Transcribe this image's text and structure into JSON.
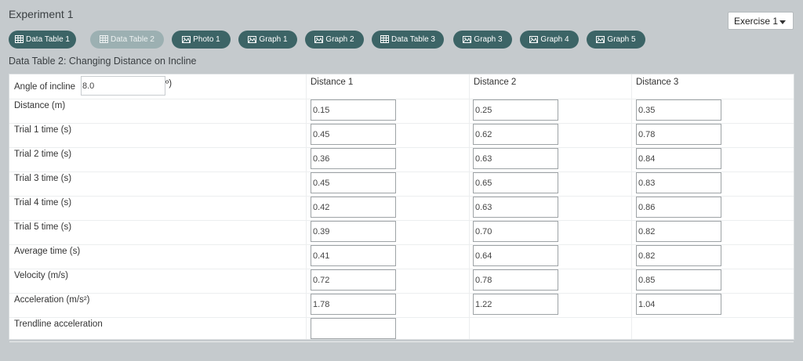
{
  "experiment_title": "Experiment 1",
  "exercise_select": {
    "value": "Exercise 1"
  },
  "tabs": [
    {
      "label": "Data Table 1",
      "icon": "table-icon"
    },
    {
      "label": "Data Table 2",
      "icon": "table-icon"
    },
    {
      "label": "Photo 1",
      "icon": "photo-icon"
    },
    {
      "label": "Graph 1",
      "icon": "graph-icon"
    },
    {
      "label": "Graph 2",
      "icon": "graph-icon"
    },
    {
      "label": "Data Table 3",
      "icon": "table-icon"
    },
    {
      "label": "Graph 3",
      "icon": "graph-icon"
    },
    {
      "label": "Graph 4",
      "icon": "graph-icon"
    },
    {
      "label": "Graph 5",
      "icon": "graph-icon"
    }
  ],
  "active_tab": "Data Table 2",
  "section_title": "Data Table 2: Changing Distance on Incline",
  "table": {
    "angle_label": "Angle of incline",
    "angle_value": "8.0",
    "angle_unit": "º)",
    "columns": [
      "Distance 1",
      "Distance 2",
      "Distance 3"
    ],
    "rows": [
      {
        "label": "Distance (m)",
        "values": [
          "0.15",
          "0.25",
          "0.35"
        ]
      },
      {
        "label": "Trial 1 time (s)",
        "values": [
          "0.45",
          "0.62",
          "0.78"
        ]
      },
      {
        "label": "Trial 2 time (s)",
        "values": [
          "0.36",
          "0.63",
          "0.84"
        ]
      },
      {
        "label": "Trial 3 time (s)",
        "values": [
          "0.45",
          "0.65",
          "0.83"
        ]
      },
      {
        "label": "Trial 4 time (s)",
        "values": [
          "0.42",
          "0.63",
          "0.86"
        ]
      },
      {
        "label": "Trial 5 time (s)",
        "values": [
          "0.39",
          "0.70",
          "0.82"
        ]
      },
      {
        "label": "Average time (s)",
        "values": [
          "0.41",
          "0.64",
          "0.82"
        ]
      },
      {
        "label": "Velocity (m/s)",
        "values": [
          "0.72",
          "0.78",
          "0.85"
        ]
      },
      {
        "label": "Acceleration (m/s²)",
        "values": [
          "1.78",
          "1.22",
          "1.04"
        ]
      },
      {
        "label": "Trendline acceleration",
        "values": [
          ""
        ]
      }
    ]
  }
}
